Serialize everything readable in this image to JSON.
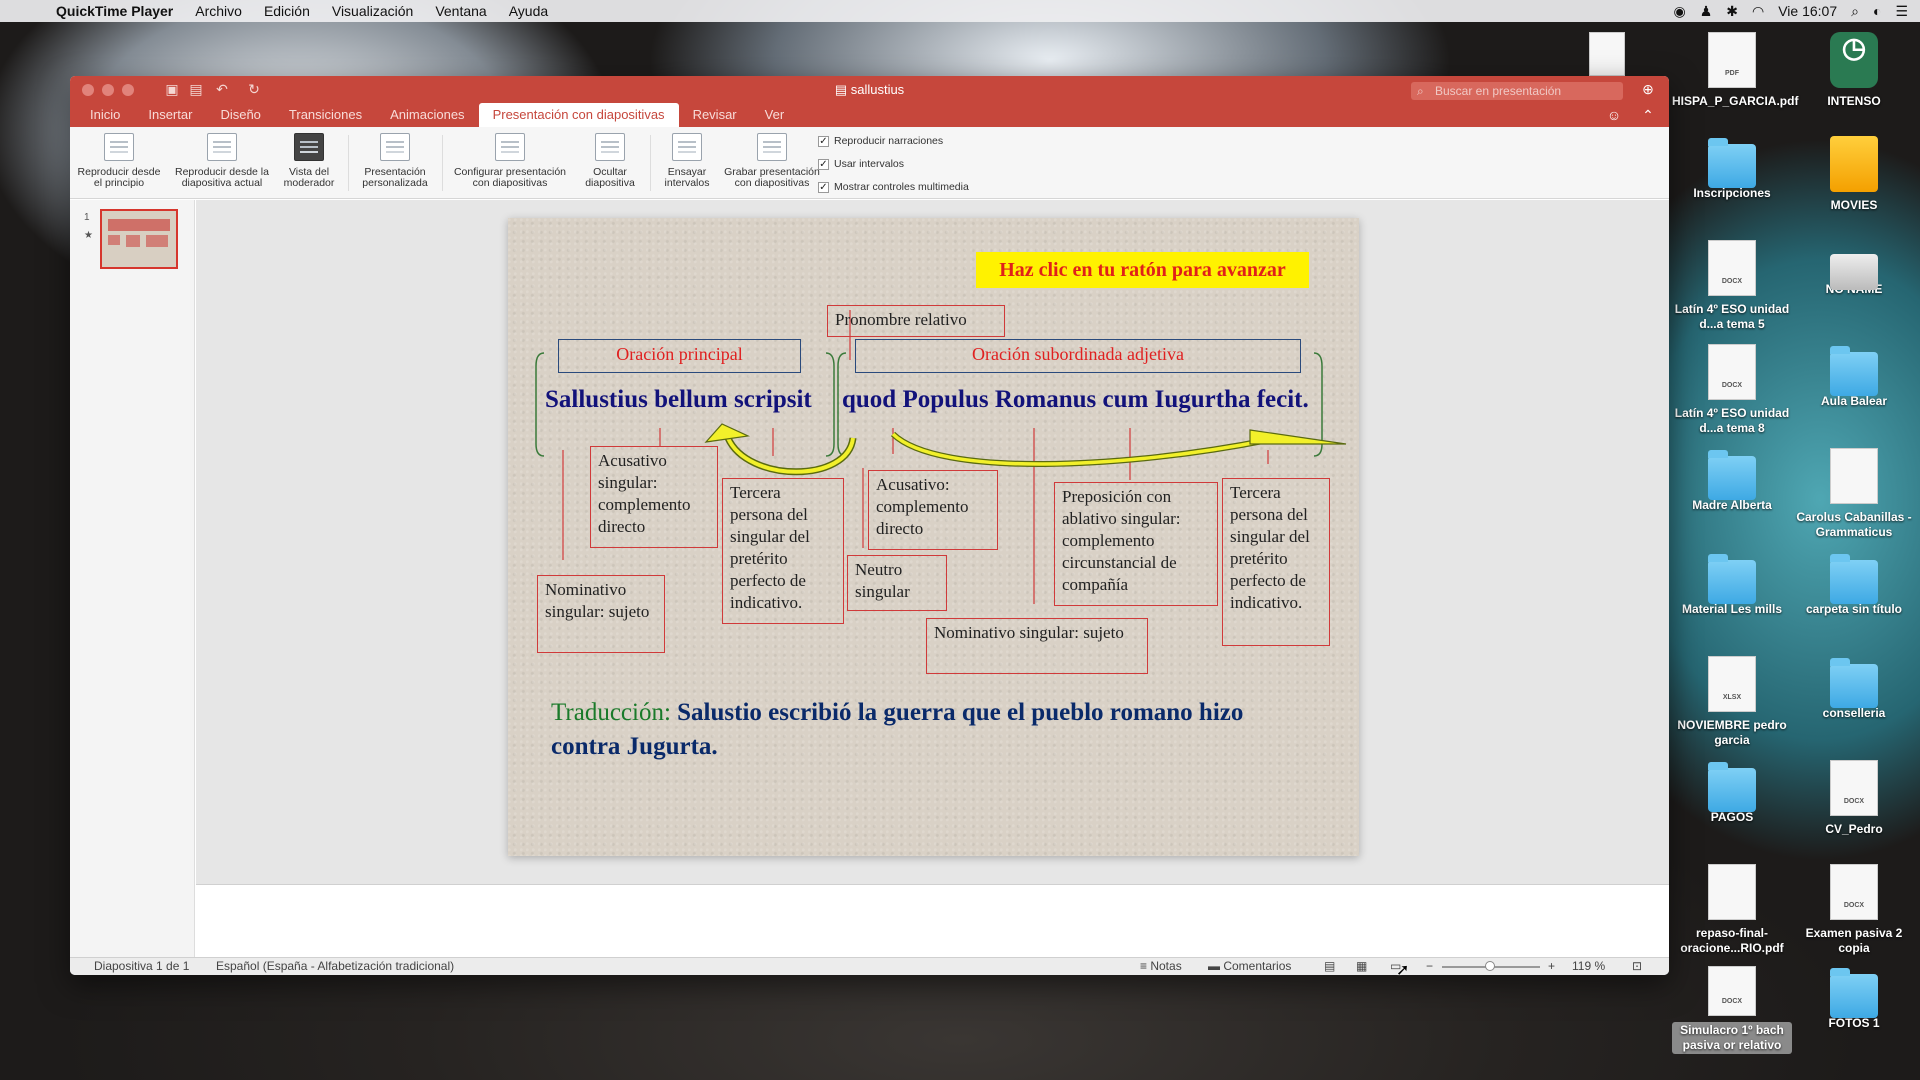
{
  "menubar": {
    "app": "QuickTime Player",
    "items": [
      "Archivo",
      "Edición",
      "Visualización",
      "Ventana",
      "Ayuda"
    ],
    "clock": "Vie 16:07"
  },
  "desktop": {
    "icons": [
      {
        "label": "HISPA_P_GARCIA.pdf",
        "kind": "pdf"
      },
      {
        "label": "INTENSO",
        "kind": "clock"
      },
      {
        "label": "Inscripciones",
        "kind": "folder"
      },
      {
        "label": "MOVIES",
        "kind": "movies"
      },
      {
        "label": "Latín 4º ESO unidad d...a tema 5",
        "kind": "docx"
      },
      {
        "label": "NO NAME",
        "kind": "drive"
      },
      {
        "label": "Latín 4º ESO unidad d...a tema 8",
        "kind": "docx"
      },
      {
        "label": "Aula Balear",
        "kind": "folder"
      },
      {
        "label": "Madre Alberta",
        "kind": "folder"
      },
      {
        "label": "Carolus Cabanillas - Grammaticus",
        "kind": "doc"
      },
      {
        "label": "Material Les mills",
        "kind": "folder"
      },
      {
        "label": "carpeta sin título",
        "kind": "folder"
      },
      {
        "label": "NOVIEMBRE pedro garcia",
        "kind": "xlsx"
      },
      {
        "label": "conselleria",
        "kind": "folder"
      },
      {
        "label": "PAGOS",
        "kind": "folder"
      },
      {
        "label": "CV_Pedro",
        "kind": "docx"
      },
      {
        "label": "repaso-final-oracione...RIO.pdf",
        "kind": "pdf"
      },
      {
        "label": "Examen pasiva 2 copia",
        "kind": "docx"
      },
      {
        "label": "Simulacro 1º bach pasiva or relativo",
        "kind": "docx"
      },
      {
        "label": "FOTOS 1",
        "kind": "folder"
      }
    ]
  },
  "window": {
    "title": "sallustius",
    "search_placeholder": "Buscar en presentación",
    "tabs": [
      "Inicio",
      "Insertar",
      "Diseño",
      "Transiciones",
      "Animaciones",
      "Presentación con diapositivas",
      "Revisar",
      "Ver"
    ],
    "ribbon": {
      "buttons": [
        "Reproducir desde el principio",
        "Reproducir desde la diapositiva actual",
        "Vista del moderador",
        "Presentación personalizada",
        "Configurar presentación con diapositivas",
        "Ocultar diapositiva",
        "Ensayar intervalos",
        "Grabar presentación con diapositivas"
      ],
      "checks": [
        "Reproducir narraciones",
        "Usar intervalos",
        "Mostrar controles multimedia"
      ]
    },
    "thumb_number": "1",
    "status": {
      "slide": "Diapositiva 1 de 1",
      "language": "Español (España - Alfabetización tradicional)",
      "notes": "Notas",
      "comments": "Comentarios",
      "zoom": "119 %"
    }
  },
  "slide": {
    "click_banner": "Haz clic en tu ratón para avanzar",
    "pronombre": "Pronombre relativo",
    "oracion_principal": "Oración principal",
    "oracion_sub": "Oración subordinada adjetiva",
    "sentence_main": "Sallustius bellum scripsit",
    "sentence_sub": "quod Populus Romanus cum Iugurtha fecit.",
    "boxes": {
      "acusativo1": "Acusativo singular: complemento directo",
      "tercera1": "Tercera persona del singular del pretérito perfecto de indicativo.",
      "acusativo2": "Acusativo: complemento directo",
      "preposicion": "Preposición con ablativo singular: complemento circunstancial de compañía",
      "tercera2": "Tercera persona del singular del pretérito perfecto de indicativo.",
      "nominativo1": "Nominativo singular: sujeto",
      "neutro": "Neutro singular",
      "nominativo2": "Nominativo singular: sujeto"
    },
    "translation_label": "Traducción:",
    "translation_text": "Salustio escribió la guerra que el pueblo romano hizo contra Jugurta."
  }
}
